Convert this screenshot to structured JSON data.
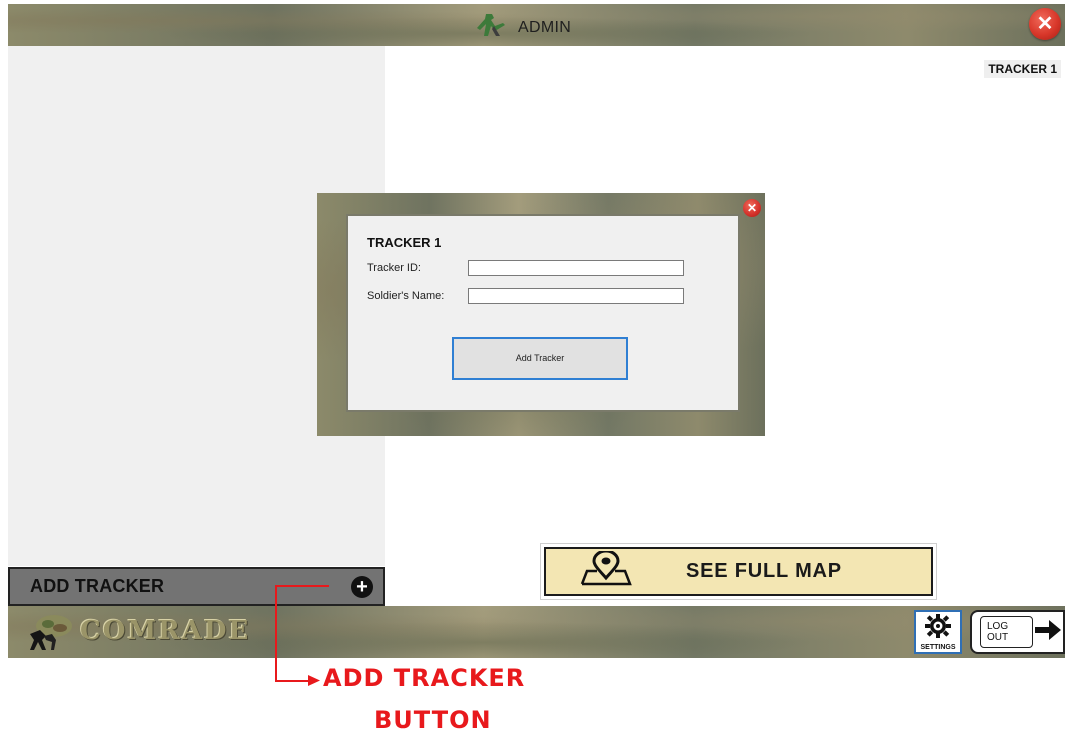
{
  "topbar": {
    "title": "ADMIN",
    "icon": "soldier-icon"
  },
  "tracker_tag": "TRACKER 1",
  "add_tracker_bar": {
    "label": "ADD TRACKER",
    "icon": "plus-circle-icon"
  },
  "map_button": {
    "label": "SEE FULL MAP",
    "icon": "map-pin-icon"
  },
  "brand": {
    "name": "COMRADE"
  },
  "settings": {
    "label": "SETTINGS",
    "icon": "gear-icon"
  },
  "logout": {
    "label": "LOG OUT",
    "icon": "logout-arrow-icon"
  },
  "dialog": {
    "heading": "TRACKER 1",
    "fields": [
      {
        "label": "Tracker ID:",
        "value": ""
      },
      {
        "label": "Soldier's Name:",
        "value": ""
      }
    ],
    "submit_label": "Add Tracker"
  },
  "annotation": {
    "line1": "ADD TRACKER",
    "line2": "BUTTON"
  },
  "colors": {
    "annotation": "#e8191c",
    "close": "#d8372a",
    "map_button_bg": "#f3e6b3",
    "focus_border": "#2f7fd3"
  }
}
